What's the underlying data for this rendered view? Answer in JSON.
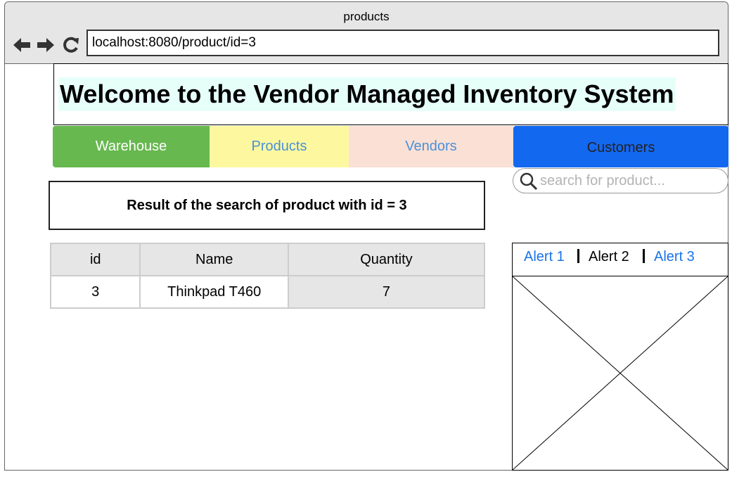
{
  "window": {
    "title": "products",
    "url": "localhost:8080/product/id=3"
  },
  "header": {
    "title": "Welcome to the Vendor Managed Inventory System"
  },
  "nav": {
    "tabs": [
      {
        "label": "Warehouse",
        "color": "#67b84f"
      },
      {
        "label": "Products",
        "color": "#fdf8a0"
      },
      {
        "label": "Vendors",
        "color": "#fbe0d5"
      },
      {
        "label": "Customers",
        "color": "#1368f0"
      }
    ]
  },
  "search": {
    "placeholder": "search for product...",
    "icon": "search-icon"
  },
  "result": {
    "heading": "Result of the search of product with id = 3"
  },
  "table": {
    "columns": [
      "id",
      "Name",
      "Quantity"
    ],
    "rows": [
      [
        "3",
        "Thinkpad T460",
        "7"
      ]
    ]
  },
  "alerts": {
    "tabs": [
      "Alert 1",
      "Alert 2",
      "Alert 3"
    ],
    "link_color": "#1a73e8"
  }
}
